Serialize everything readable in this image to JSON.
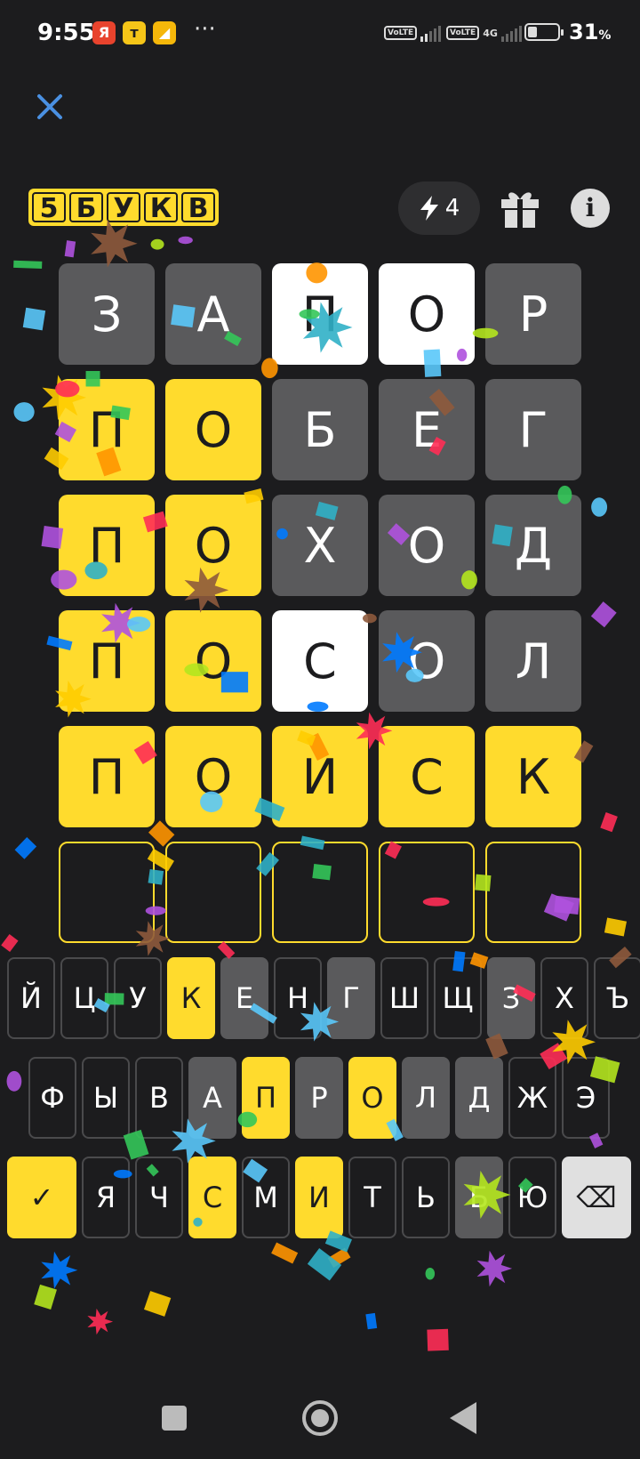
{
  "status_bar": {
    "time": "9:55",
    "app_icons": [
      {
        "name": "yandex-icon",
        "glyph": "Я",
        "color": "#e8432d"
      },
      {
        "name": "shield-app-icon",
        "glyph": "т",
        "color": "#f5c518"
      },
      {
        "name": "notes-app-icon",
        "glyph": "◢",
        "color": "#f5b70a"
      }
    ],
    "more": "···",
    "network_1": "VoLTE",
    "network_2": "VoLTE",
    "network_type": "4G",
    "battery_percent": "31",
    "battery_unit": "%",
    "battery_level": 0.31
  },
  "header": {
    "close_icon": "close-icon",
    "logo_letters": [
      "5",
      "Б",
      "У",
      "К",
      "В"
    ],
    "hints_count": "4",
    "colors": {
      "accent": "#ffdb2d",
      "close": "#4a90e2"
    }
  },
  "board": {
    "rows": [
      [
        {
          "l": "З",
          "s": "gray"
        },
        {
          "l": "А",
          "s": "gray"
        },
        {
          "l": "П",
          "s": "white"
        },
        {
          "l": "О",
          "s": "white"
        },
        {
          "l": "Р",
          "s": "gray"
        }
      ],
      [
        {
          "l": "П",
          "s": "yellow"
        },
        {
          "l": "О",
          "s": "yellow"
        },
        {
          "l": "Б",
          "s": "gray"
        },
        {
          "l": "Е",
          "s": "gray"
        },
        {
          "l": "Г",
          "s": "gray"
        }
      ],
      [
        {
          "l": "П",
          "s": "yellow"
        },
        {
          "l": "О",
          "s": "yellow"
        },
        {
          "l": "Х",
          "s": "gray"
        },
        {
          "l": "О",
          "s": "gray"
        },
        {
          "l": "Д",
          "s": "gray"
        }
      ],
      [
        {
          "l": "П",
          "s": "yellow"
        },
        {
          "l": "О",
          "s": "yellow"
        },
        {
          "l": "С",
          "s": "white"
        },
        {
          "l": "О",
          "s": "gray"
        },
        {
          "l": "Л",
          "s": "gray"
        }
      ],
      [
        {
          "l": "П",
          "s": "yellow"
        },
        {
          "l": "О",
          "s": "yellow"
        },
        {
          "l": "И",
          "s": "yellow"
        },
        {
          "l": "С",
          "s": "yellow"
        },
        {
          "l": "К",
          "s": "yellow"
        }
      ],
      [
        {
          "l": "",
          "s": "empty"
        },
        {
          "l": "",
          "s": "empty"
        },
        {
          "l": "",
          "s": "empty"
        },
        {
          "l": "",
          "s": "empty"
        },
        {
          "l": "",
          "s": "empty"
        }
      ]
    ]
  },
  "keyboard": {
    "row1": [
      {
        "k": "Й",
        "s": "dark"
      },
      {
        "k": "Ц",
        "s": "dark"
      },
      {
        "k": "У",
        "s": "dark"
      },
      {
        "k": "К",
        "s": "yellow"
      },
      {
        "k": "Е",
        "s": "gray"
      },
      {
        "k": "Н",
        "s": "dark"
      },
      {
        "k": "Г",
        "s": "gray"
      },
      {
        "k": "Ш",
        "s": "dark"
      },
      {
        "k": "Щ",
        "s": "dark"
      },
      {
        "k": "З",
        "s": "gray"
      },
      {
        "k": "Х",
        "s": "dark"
      },
      {
        "k": "Ъ",
        "s": "dark"
      }
    ],
    "row2": [
      {
        "k": "Ф",
        "s": "dark"
      },
      {
        "k": "Ы",
        "s": "dark"
      },
      {
        "k": "В",
        "s": "dark"
      },
      {
        "k": "А",
        "s": "gray"
      },
      {
        "k": "П",
        "s": "yellow"
      },
      {
        "k": "Р",
        "s": "gray"
      },
      {
        "k": "О",
        "s": "yellow"
      },
      {
        "k": "Л",
        "s": "gray"
      },
      {
        "k": "Д",
        "s": "gray"
      },
      {
        "k": "Ж",
        "s": "dark"
      },
      {
        "k": "Э",
        "s": "dark"
      }
    ],
    "row3": [
      {
        "k": "✓",
        "s": "enter"
      },
      {
        "k": "Я",
        "s": "dark"
      },
      {
        "k": "Ч",
        "s": "dark"
      },
      {
        "k": "С",
        "s": "yellow"
      },
      {
        "k": "М",
        "s": "dark"
      },
      {
        "k": "И",
        "s": "yellow"
      },
      {
        "k": "Т",
        "s": "dark"
      },
      {
        "k": "Ь",
        "s": "dark"
      },
      {
        "k": "Б",
        "s": "gray"
      },
      {
        "k": "Ю",
        "s": "dark"
      },
      {
        "k": "⌫",
        "s": "back"
      }
    ]
  },
  "nav_bar": {
    "recents": "recents-icon",
    "home": "home-icon",
    "back": "back-icon"
  },
  "confetti_colors": [
    "#ff2d55",
    "#34c759",
    "#007aff",
    "#ffcc00",
    "#af52de",
    "#ff9500",
    "#30b0c7",
    "#5ac8fa",
    "#8e5a3c",
    "#b4e61e"
  ]
}
